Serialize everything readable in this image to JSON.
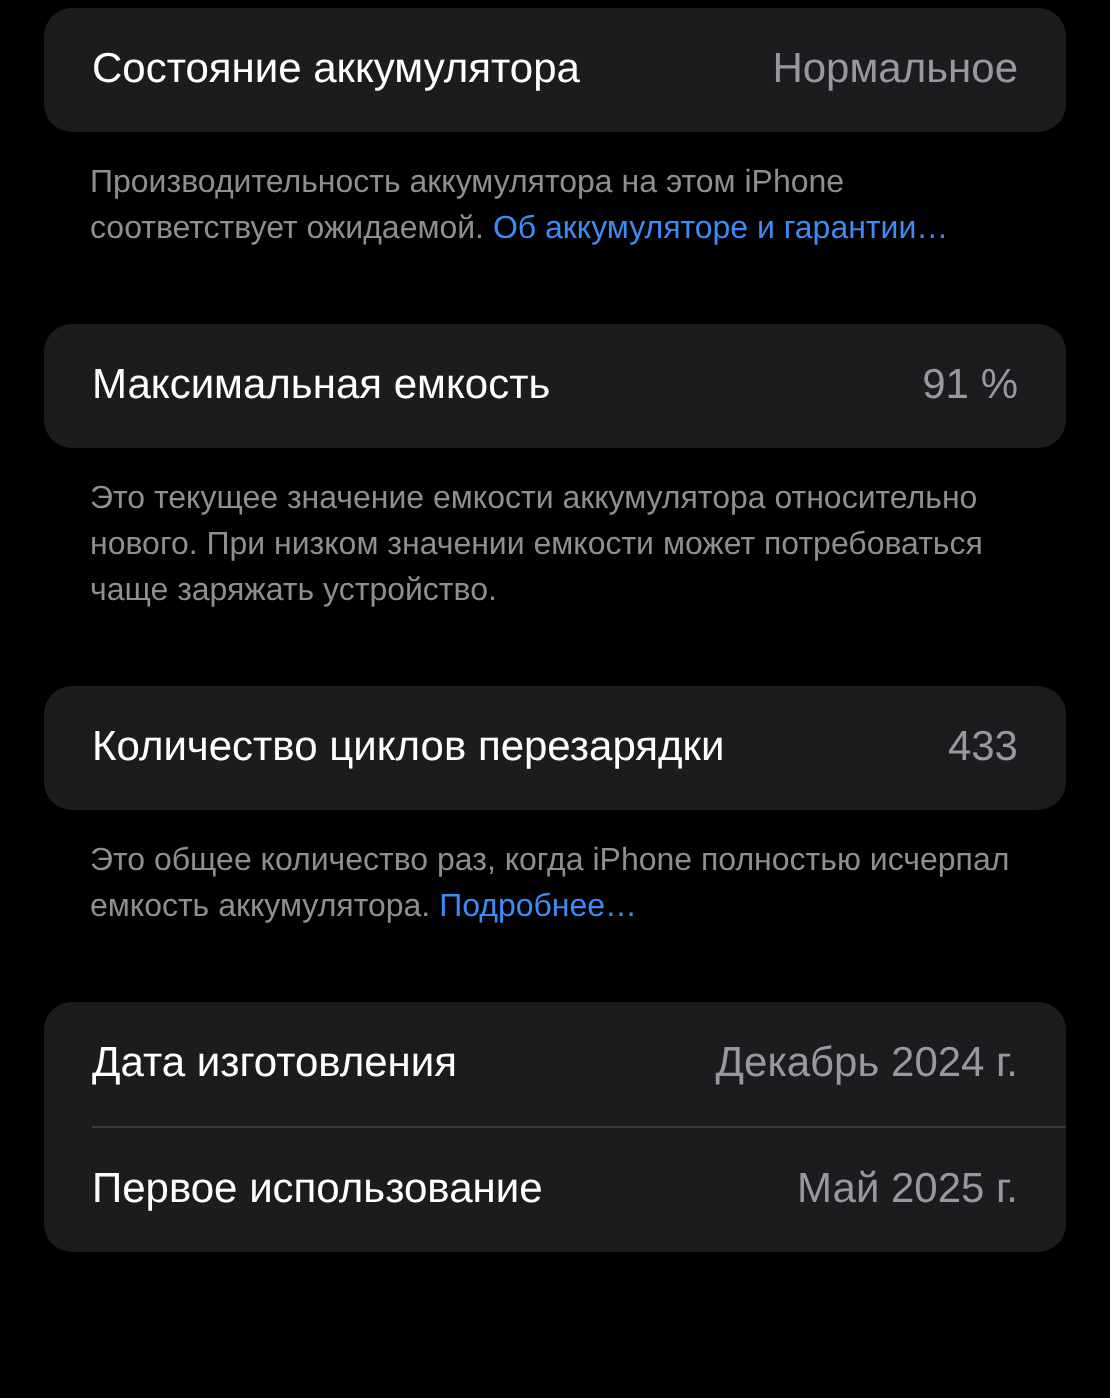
{
  "sections": [
    {
      "rows": [
        {
          "label": "Состояние аккумулятора",
          "value": "Нормальное"
        }
      ],
      "footer": {
        "text": "Производительность аккумулятора на этом iPhone соответствует ожидаемой.",
        "link": "Об аккумуляторе и гарантии…"
      }
    },
    {
      "rows": [
        {
          "label": "Максимальная емкость",
          "value": "91 %"
        }
      ],
      "footer": {
        "text": "Это текущее значение емкости аккумулятора относительно нового. При низком значении емкости может потребоваться чаще заряжать устройство."
      }
    },
    {
      "rows": [
        {
          "label": "Количество циклов перезарядки",
          "value": "433"
        }
      ],
      "footer": {
        "text": "Это общее количество раз, когда iPhone полностью исчерпал емкость аккумулятора.",
        "link": "Подробнее…"
      }
    },
    {
      "rows": [
        {
          "label": "Дата изготовления",
          "value": "Декабрь 2024 г."
        },
        {
          "label": "Первое использование",
          "value": "Май 2025 г."
        }
      ]
    }
  ]
}
